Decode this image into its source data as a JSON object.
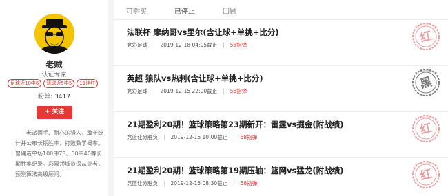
{
  "profile": {
    "name": "老贼",
    "role": "认证专家",
    "badges": [
      "足球近10中6",
      "篮球近5中5",
      "11连红"
    ],
    "fans_label": "粉丝:",
    "fans_count": "3417",
    "follow_label": "关注",
    "follow_icon": "plus-icon",
    "bio": "老派两手、耐心的猎人，敢于统计并公布长期胜率，打败数学概率。曾确造单场100中73、50中40等长期胜率纪录。彩票领域资深从业者，预测算法高级顾问。",
    "avatar_icon": "bearded-man-hat-glasses-avatar"
  },
  "tabs": [
    {
      "label": "可购买",
      "active": false
    },
    {
      "label": "已停止",
      "active": true
    },
    {
      "label": "回顾",
      "active": false
    }
  ],
  "items": [
    {
      "title": "法联杯 摩纳哥vs里尔(含让球+单挑+比分)",
      "category": "竞彩足球",
      "datetime": "2019-12-18 04:05截止",
      "price": "58指弹",
      "stamp_text": "红",
      "stamp_color": "#e8a0a0"
    },
    {
      "title": "英超 狼队vs热刺(含让球+单挑+比分)",
      "category": "竞彩足球",
      "datetime": "2019-12-15 22:00截止",
      "price": "58指弹",
      "stamp_text": "黑",
      "stamp_color": "#7a7a7a"
    },
    {
      "title": "21期盈利20期！篮球策略第23期新开：雷霆vs掘金(附战绩)",
      "category": "竞篮让分胜负",
      "datetime": "2019-12-15 10:00截止",
      "price": "58指弹",
      "stamp_text": "红",
      "stamp_color": "#e8a0a0"
    },
    {
      "title": "21期盈利20期！篮球策略第19期压轴：篮网vs猛龙(附战绩)",
      "category": "竞篮让分胜负",
      "datetime": "2019-12-15 08:30截止",
      "price": "58指弹",
      "stamp_text": "红",
      "stamp_color": "#e8a0a0"
    }
  ],
  "colors": {
    "accent": "#e53935",
    "stamp_red": "#e8a0a0",
    "stamp_black": "#7a7a7a",
    "avatar_bg": "#f5c400"
  }
}
